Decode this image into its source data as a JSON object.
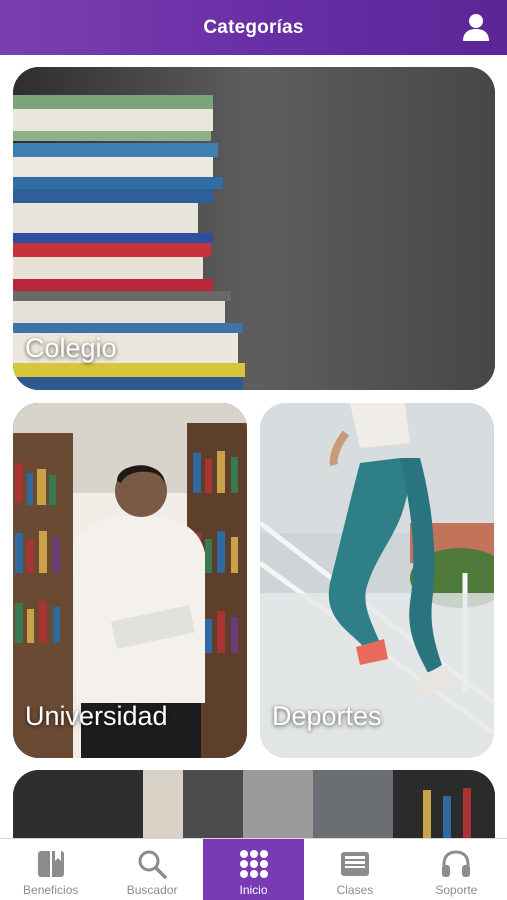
{
  "header": {
    "title": "Categorías",
    "profile_icon": "user-icon"
  },
  "categories": [
    {
      "label": "Colegio"
    },
    {
      "label": "Universidad"
    },
    {
      "label": "Deportes"
    },
    {
      "label": ""
    }
  ],
  "tabbar": {
    "tabs": [
      {
        "label": "Beneficios",
        "icon": "book-icon",
        "active": false
      },
      {
        "label": "Buscador",
        "icon": "search-icon",
        "active": false
      },
      {
        "label": "Inicio",
        "icon": "grid-icon",
        "active": true
      },
      {
        "label": "Clases",
        "icon": "inbox-icon",
        "active": false
      },
      {
        "label": "Soporte",
        "icon": "headphones-icon",
        "active": false
      }
    ]
  },
  "colors": {
    "accent": "#7a3ab3",
    "inactive": "#8c8c8c"
  }
}
